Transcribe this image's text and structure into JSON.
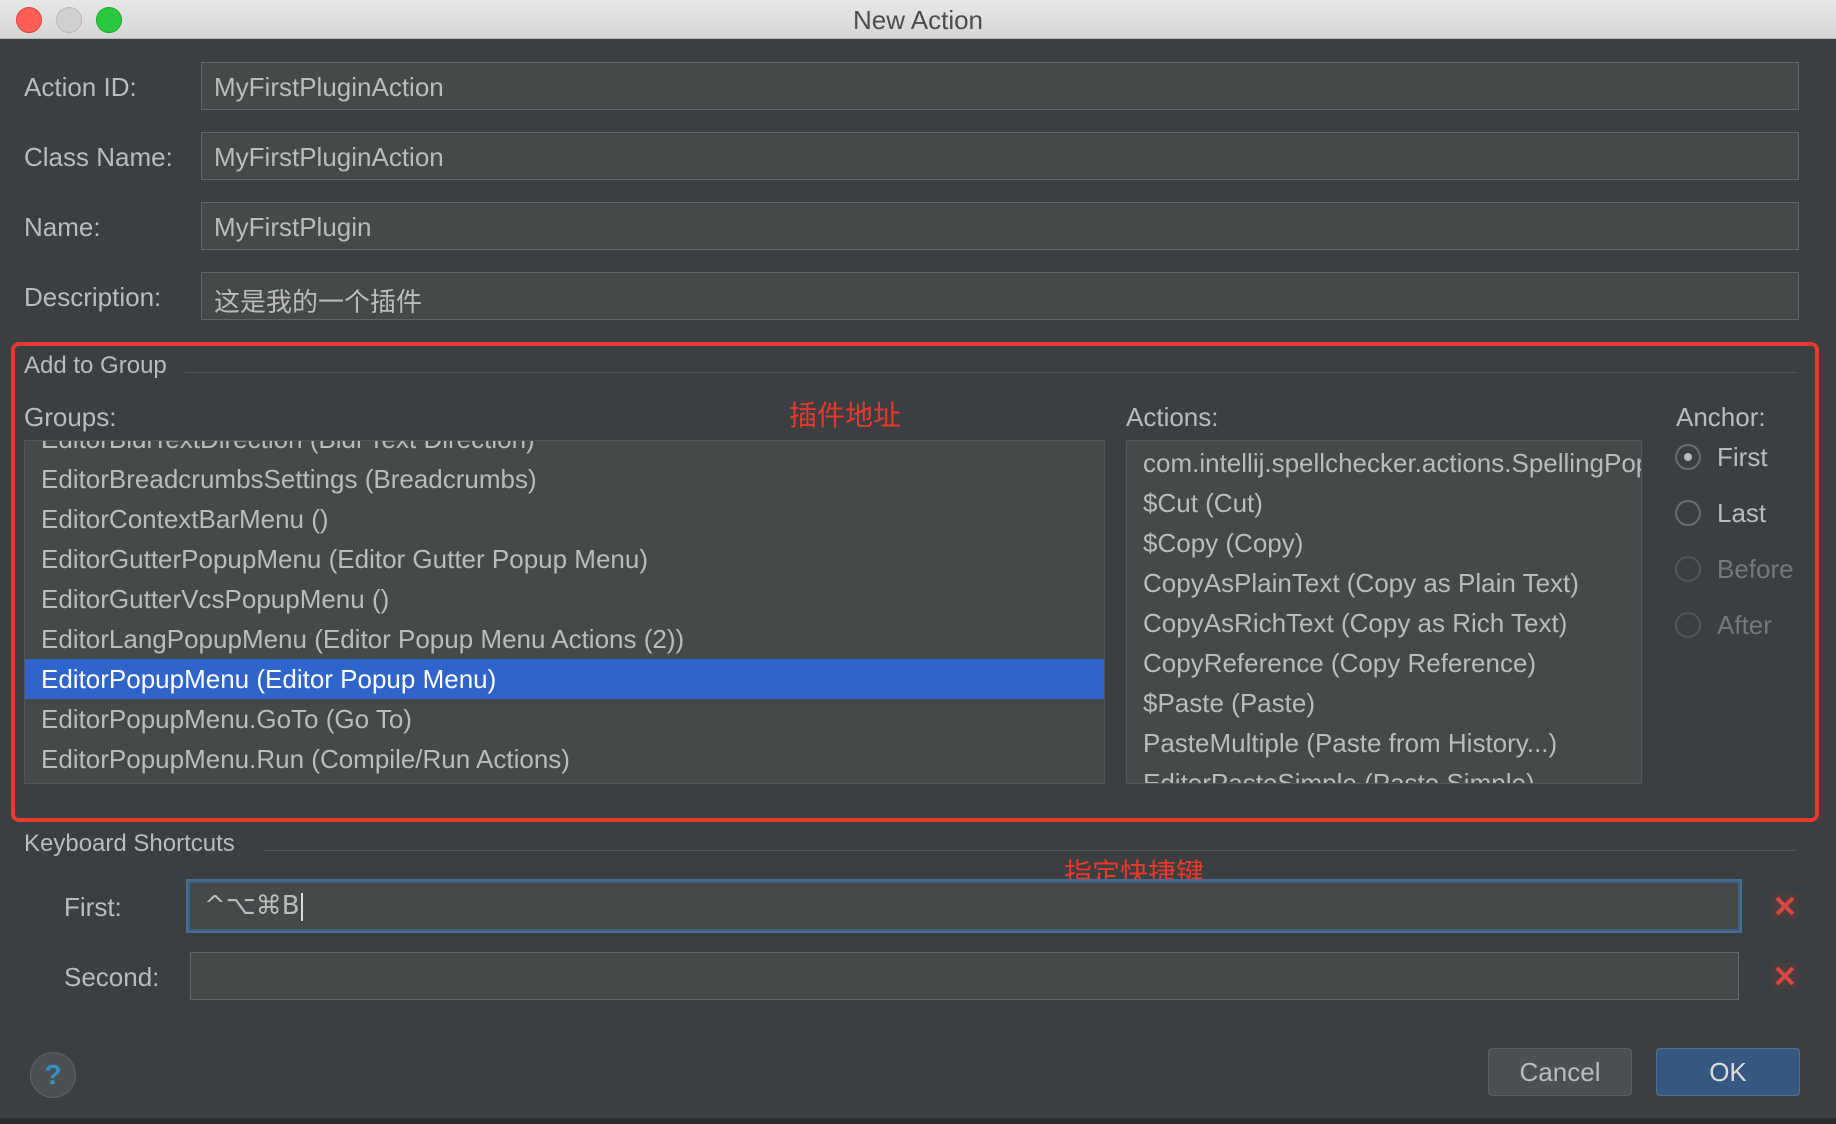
{
  "window": {
    "title": "New Action"
  },
  "form": {
    "action_id_label": "Action ID:",
    "action_id_value": "MyFirstPluginAction",
    "class_name_label": "Class Name:",
    "class_name_value": "MyFirstPluginAction",
    "name_label": "Name:",
    "name_value": "MyFirstPlugin",
    "description_label": "Description:",
    "description_value": "这是我的一个插件"
  },
  "add_to_group": {
    "section_title": "Add to Group",
    "groups_label": "Groups:",
    "annotation": "插件地址",
    "groups": [
      {
        "label": "EditorBidiTextDirection (Bidi Text Direction)",
        "selected": false
      },
      {
        "label": "EditorBreadcrumbsSettings (Breadcrumbs)",
        "selected": false
      },
      {
        "label": "EditorContextBarMenu ()",
        "selected": false
      },
      {
        "label": "EditorGutterPopupMenu (Editor Gutter Popup Menu)",
        "selected": false
      },
      {
        "label": "EditorGutterVcsPopupMenu ()",
        "selected": false
      },
      {
        "label": "EditorLangPopupMenu (Editor Popup Menu Actions (2))",
        "selected": false
      },
      {
        "label": "EditorPopupMenu (Editor Popup Menu)",
        "selected": true
      },
      {
        "label": "EditorPopupMenu.GoTo (Go To)",
        "selected": false
      },
      {
        "label": "EditorPopupMenu.Run (Compile/Run Actions)",
        "selected": false
      }
    ],
    "actions_label": "Actions:",
    "actions": [
      "com.intellij.spellchecker.actions.SpellingPopupActionGroup",
      "$Cut (Cut)",
      "$Copy (Copy)",
      "CopyAsPlainText (Copy as Plain Text)",
      "CopyAsRichText (Copy as Rich Text)",
      "CopyReference (Copy Reference)",
      "$Paste (Paste)",
      "PasteMultiple (Paste from History...)",
      "EditorPasteSimple (Paste Simple)"
    ],
    "anchor_label": "Anchor:",
    "anchors": [
      {
        "label": "First",
        "checked": true,
        "enabled": true
      },
      {
        "label": "Last",
        "checked": false,
        "enabled": true
      },
      {
        "label": "Before",
        "checked": false,
        "enabled": false
      },
      {
        "label": "After",
        "checked": false,
        "enabled": false
      }
    ]
  },
  "keyboard_shortcuts": {
    "section_title": "Keyboard Shortcuts",
    "annotation": "指定快捷键",
    "first_label": "First:",
    "first_value": "^⌥⌘B",
    "second_label": "Second:",
    "second_value": ""
  },
  "buttons": {
    "help": "?",
    "cancel": "Cancel",
    "ok": "OK"
  },
  "colors": {
    "background": "#3c3f41",
    "selection": "#2f65ca",
    "annotation_red": "#e53b2f",
    "clear_icon_red": "#c75450"
  }
}
